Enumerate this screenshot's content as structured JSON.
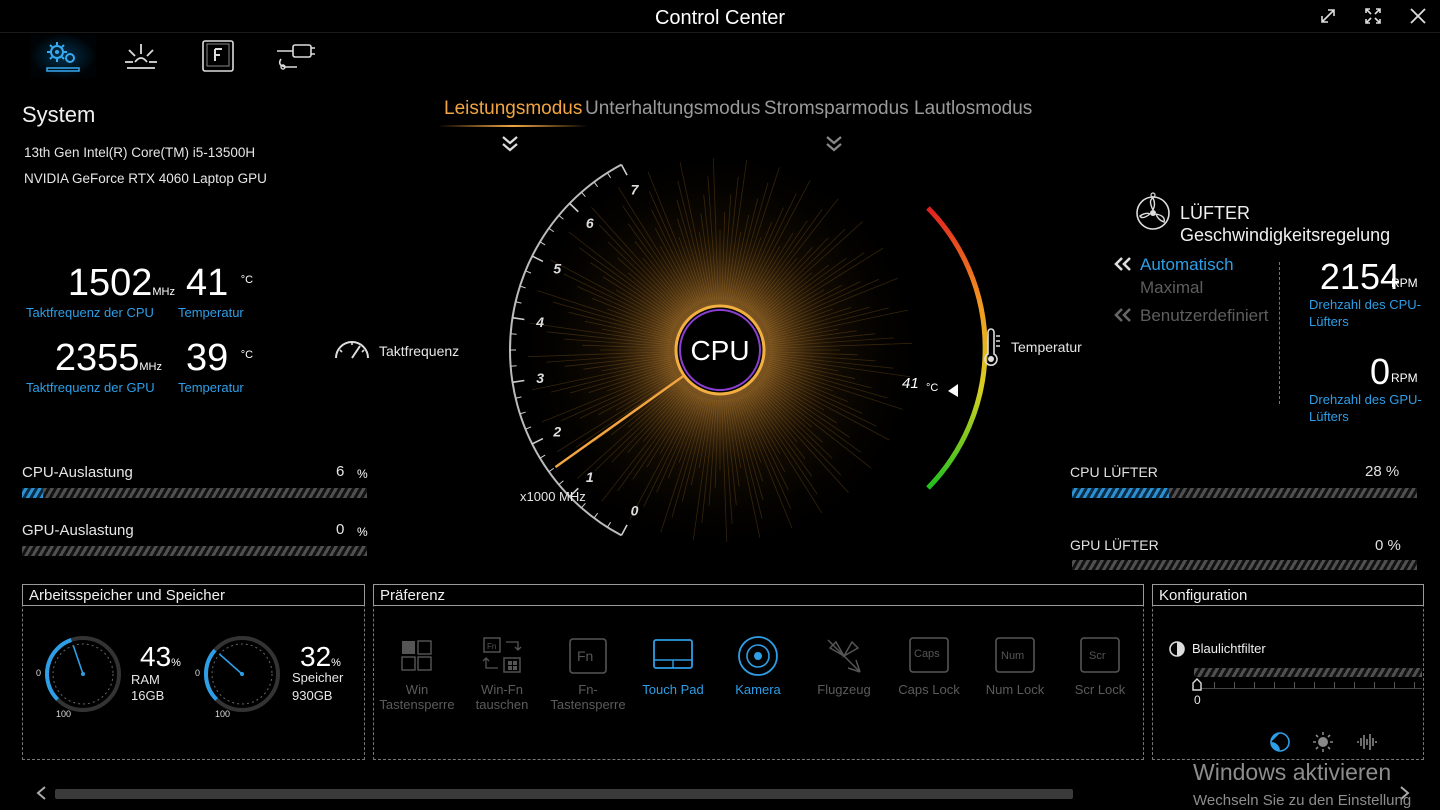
{
  "window": {
    "title": "Control Center"
  },
  "nav": [
    {
      "icon": "system-gear-icon"
    },
    {
      "icon": "lighting-icon"
    },
    {
      "icon": "function-key-icon"
    },
    {
      "icon": "hardware-plug-icon"
    }
  ],
  "system": {
    "title": "System",
    "cpu_name": "13th Gen Intel(R) Core(TM) i5-13500H",
    "gpu_name": "NVIDIA GeForce RTX 4060 Laptop GPU",
    "cpu_clock": "1502",
    "cpu_clock_unit": "MHz",
    "cpu_clock_label": "Taktfrequenz der CPU",
    "cpu_temp": "41",
    "cpu_temp_unit": "°C",
    "cpu_temp_label": "Temperatur",
    "gpu_clock": "2355",
    "gpu_clock_unit": "MHz",
    "gpu_clock_label": "Taktfrequenz der GPU",
    "gpu_temp": "39",
    "gpu_temp_unit": "°C",
    "gpu_temp_label": "Temperatur",
    "cpu_load_label": "CPU-Auslastung",
    "cpu_load": "6",
    "cpu_load_fraction": 0.06,
    "gpu_load_label": "GPU-Auslastung",
    "gpu_load": "0",
    "gpu_load_fraction": 0.0,
    "percent_unit": "%"
  },
  "modes": {
    "items": [
      "Leistungsmodus",
      "Unterhaltungsmodus",
      "Stromsparmodus",
      "Lautlosmodus"
    ],
    "active_index": 0
  },
  "gauge": {
    "center_label": "CPU",
    "left_label": "Taktfrequenz",
    "right_label": "Temperatur",
    "scale_unit": "x1000 MHz",
    "ticks": [
      "0",
      "1",
      "2",
      "3",
      "4",
      "5",
      "6",
      "7"
    ],
    "clock_value_ghz": 1.5,
    "temp_value": "41",
    "temp_unit": "°C"
  },
  "fan": {
    "title_line1": "LÜFTER",
    "title_line2": "Geschwindigkeitsregelung",
    "options": [
      "Automatisch",
      "Maximal",
      "Benutzerdefiniert"
    ],
    "cpu_rpm": "2154",
    "rpm_unit": "RPM",
    "cpu_rpm_label": "Drehzahl des CPU-Lüfters",
    "gpu_rpm": "0",
    "gpu_rpm_label": "Drehzahl des GPU-Lüfters",
    "cpu_fan_label": "CPU LÜFTER",
    "cpu_fan_pct": "28 %",
    "cpu_fan_fraction": 0.28,
    "gpu_fan_label": "GPU LÜFTER",
    "gpu_fan_pct": "0 %",
    "gpu_fan_fraction": 0.0
  },
  "memory": {
    "title": "Arbeitsspeicher und Speicher",
    "ram_pct": "43",
    "ram_label": "RAM",
    "ram_size": "16GB",
    "ram_fraction": 0.43,
    "disk_pct": "32",
    "disk_label": "Speicher",
    "disk_size": "930GB",
    "disk_fraction": 0.32,
    "pct_unit": "%",
    "dial_min": "0",
    "dial_max": "100"
  },
  "preference": {
    "title": "Präferenz",
    "items": [
      {
        "label": "Win Tastensperre",
        "active": false,
        "icon": "windows-lock-icon"
      },
      {
        "label": "Win-Fn tauschen",
        "active": false,
        "icon": "swap-icon"
      },
      {
        "label": "Fn-Tastensperre",
        "active": false,
        "icon": "fn-key-icon",
        "key": "Fn"
      },
      {
        "label": "Touch Pad",
        "active": true,
        "icon": "touchpad-icon"
      },
      {
        "label": "Kamera",
        "active": true,
        "icon": "camera-icon"
      },
      {
        "label": "Flugzeug",
        "active": false,
        "icon": "airplane-icon"
      },
      {
        "label": "Caps Lock",
        "active": false,
        "icon": "caps-lock-icon",
        "key": "Caps"
      },
      {
        "label": "Num Lock",
        "active": false,
        "icon": "num-lock-icon",
        "key": "Num"
      },
      {
        "label": "Scr Lock",
        "active": false,
        "icon": "scroll-lock-icon",
        "key": "Scr"
      }
    ]
  },
  "config": {
    "title": "Konfiguration",
    "bluelight_label": "Blaulichtfilter",
    "bluelight_value": "0"
  },
  "watermark": {
    "line1": "Windows aktivieren",
    "line2": "Wechseln Sie zu den Einstellung"
  },
  "colors": {
    "accent_blue": "#2e9ee6",
    "accent_orange": "#f2a541"
  }
}
